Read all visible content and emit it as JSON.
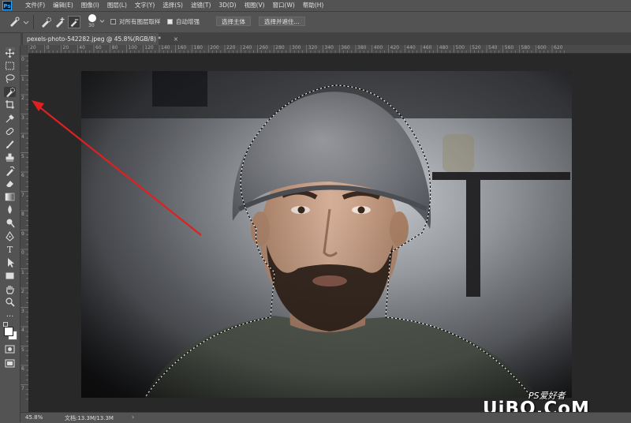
{
  "app": {
    "logo": "Ps"
  },
  "menu": [
    "文件(F)",
    "编辑(E)",
    "图像(I)",
    "图层(L)",
    "文字(Y)",
    "选择(S)",
    "滤镜(T)",
    "3D(D)",
    "视图(V)",
    "窗口(W)",
    "帮助(H)"
  ],
  "options": {
    "brush_size": "30",
    "sample_all_layers_label": "对所有图层取样",
    "sample_all_layers_checked": false,
    "auto_enhance_label": "自动增强",
    "auto_enhance_checked": true,
    "select_subject_label": "选择主体",
    "select_and_mask_label": "选择并遮住..."
  },
  "document_tab": {
    "title": "pexels-photo-542282.jpeg @ 45.8%(RGB/8) *",
    "close": "×"
  },
  "ruler_h": [
    "20",
    "0",
    "20",
    "40",
    "60",
    "80",
    "100",
    "120",
    "140",
    "160",
    "180",
    "200",
    "220",
    "240",
    "260",
    "280",
    "300",
    "320",
    "340",
    "360",
    "380",
    "400",
    "420",
    "440",
    "460",
    "480",
    "500",
    "520",
    "540",
    "560",
    "580",
    "600",
    "620"
  ],
  "ruler_v": [
    "0",
    "1",
    "2",
    "3",
    "4",
    "5",
    "6",
    "7",
    "8",
    "9",
    "0",
    "1",
    "2",
    "3",
    "4",
    "5",
    "6",
    "7"
  ],
  "status": {
    "zoom": "45.8%",
    "doc": "文档:13.3M/13.3M",
    "arrow": "›"
  },
  "watermark": {
    "line1": "PS爱好者",
    "line2": "UiBQ.CoM"
  },
  "colors": {
    "ui_bg": "#535353",
    "canvas_bg": "#282828",
    "accent": "#31a8ff",
    "arrow": "#e02020"
  },
  "tools": [
    "move-icon",
    "marquee-icon",
    "lasso-icon",
    "quick-selection-icon",
    "crop-icon",
    "eyedropper-icon",
    "healing-brush-icon",
    "brush-icon",
    "clone-stamp-icon",
    "history-brush-icon",
    "eraser-icon",
    "gradient-icon",
    "blur-icon",
    "dodge-icon",
    "pen-icon",
    "type-icon",
    "path-selection-icon",
    "shape-icon",
    "hand-icon",
    "zoom-icon",
    "more-tools-icon",
    "color-swatches",
    "quick-mask-icon",
    "screen-mode-icon"
  ]
}
